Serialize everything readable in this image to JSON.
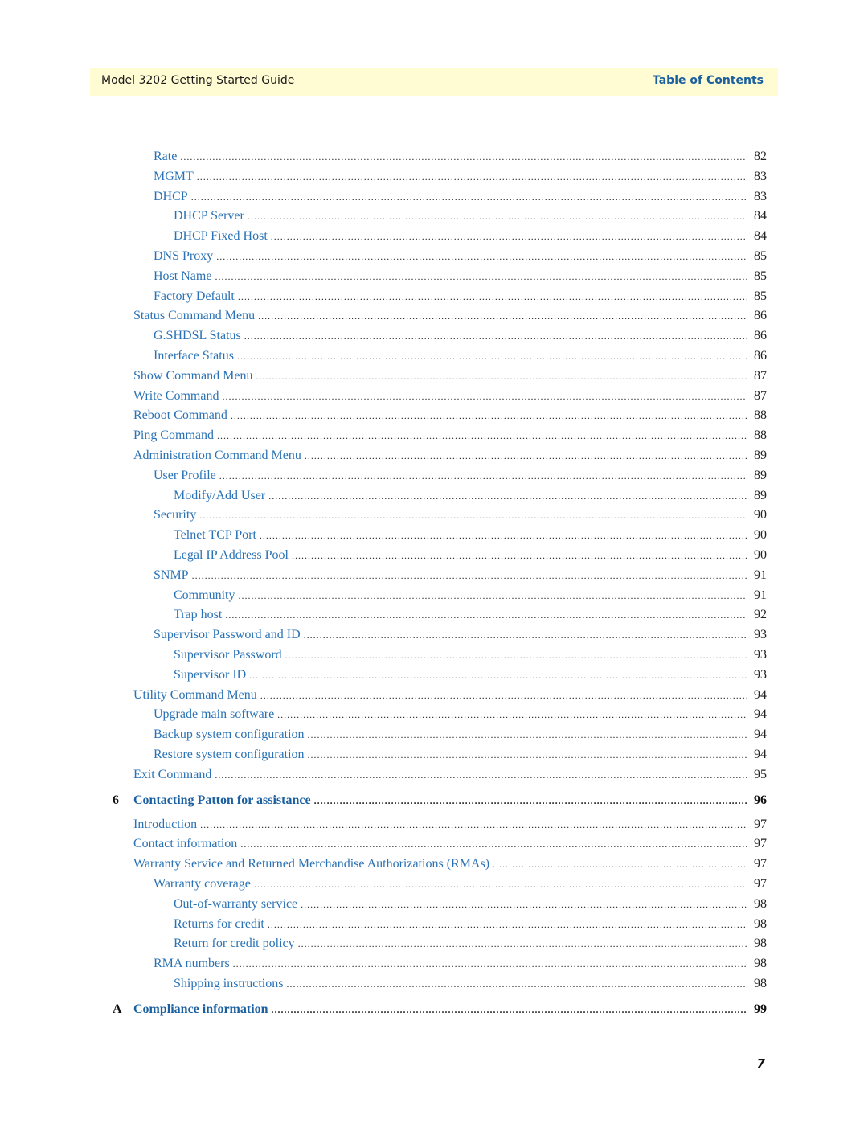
{
  "header": {
    "title": "Model 3202 Getting Started Guide",
    "section": "Table of Contents"
  },
  "toc": [
    {
      "level": 2,
      "label": "Rate",
      "page": "82"
    },
    {
      "level": 2,
      "label": "MGMT",
      "page": "83"
    },
    {
      "level": 2,
      "label": "DHCP",
      "page": "83"
    },
    {
      "level": 3,
      "label": "DHCP Server",
      "page": "84"
    },
    {
      "level": 3,
      "label": "DHCP Fixed Host",
      "page": "84"
    },
    {
      "level": 2,
      "label": "DNS Proxy",
      "page": "85"
    },
    {
      "level": 2,
      "label": "Host Name",
      "page": "85"
    },
    {
      "level": 2,
      "label": "Factory Default",
      "page": "85"
    },
    {
      "level": 1,
      "label": "Status Command Menu",
      "page": "86"
    },
    {
      "level": 2,
      "label": "G.SHDSL Status",
      "page": "86"
    },
    {
      "level": 2,
      "label": "Interface Status",
      "page": "86"
    },
    {
      "level": 1,
      "label": "Show Command Menu",
      "page": "87"
    },
    {
      "level": 1,
      "label": "Write Command",
      "page": "87"
    },
    {
      "level": 1,
      "label": "Reboot Command",
      "page": "88"
    },
    {
      "level": 1,
      "label": "Ping Command",
      "page": "88"
    },
    {
      "level": 1,
      "label": "Administration Command Menu",
      "page": "89"
    },
    {
      "level": 2,
      "label": "User Profile",
      "page": "89"
    },
    {
      "level": 3,
      "label": "Modify/Add User",
      "page": "89"
    },
    {
      "level": 2,
      "label": "Security",
      "page": "90"
    },
    {
      "level": 3,
      "label": "Telnet TCP Port",
      "page": "90"
    },
    {
      "level": 3,
      "label": "Legal IP Address Pool",
      "page": "90"
    },
    {
      "level": 2,
      "label": "SNMP",
      "page": "91"
    },
    {
      "level": 3,
      "label": "Community",
      "page": "91"
    },
    {
      "level": 3,
      "label": "Trap host",
      "page": "92"
    },
    {
      "level": 2,
      "label": "Supervisor Password and ID",
      "page": "93"
    },
    {
      "level": 3,
      "label": "Supervisor Password",
      "page": "93"
    },
    {
      "level": 3,
      "label": "Supervisor ID",
      "page": "93"
    },
    {
      "level": 1,
      "label": "Utility Command Menu",
      "page": "94"
    },
    {
      "level": 2,
      "label": "Upgrade main software",
      "page": "94"
    },
    {
      "level": 2,
      "label": "Backup system configuration",
      "page": "94"
    },
    {
      "level": 2,
      "label": "Restore system configuration",
      "page": "94"
    },
    {
      "level": 1,
      "label": "Exit Command",
      "page": "95"
    },
    {
      "level": 0,
      "number": "6",
      "label": "Contacting Patton for assistance",
      "page": "96"
    },
    {
      "level": 1,
      "label": "Introduction",
      "page": "97"
    },
    {
      "level": 1,
      "label": "Contact information",
      "page": "97"
    },
    {
      "level": 1,
      "label": "Warranty Service and Returned Merchandise Authorizations (RMAs)",
      "page": "97"
    },
    {
      "level": 2,
      "label": "Warranty coverage",
      "page": "97"
    },
    {
      "level": 3,
      "label": "Out-of-warranty service",
      "page": "98"
    },
    {
      "level": 3,
      "label": "Returns for credit",
      "page": "98"
    },
    {
      "level": 3,
      "label": "Return for credit policy",
      "page": "98"
    },
    {
      "level": 2,
      "label": "RMA numbers",
      "page": "98"
    },
    {
      "level": 3,
      "label": "Shipping instructions",
      "page": "98"
    },
    {
      "level": 0,
      "number": "A",
      "label": "Compliance information",
      "page": "99"
    }
  ],
  "footer": {
    "page_number": "7"
  }
}
